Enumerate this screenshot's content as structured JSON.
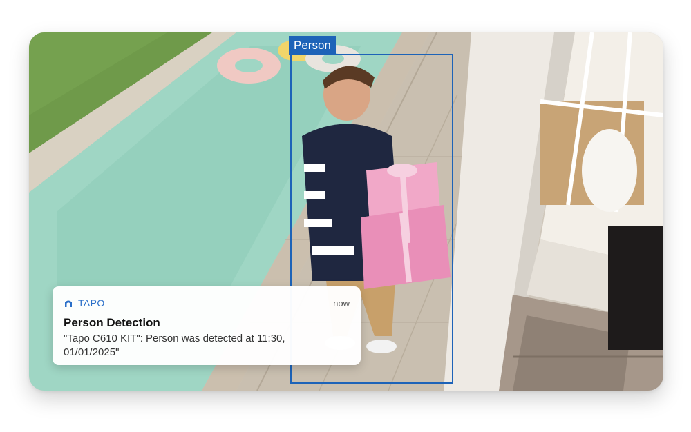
{
  "detection": {
    "label": "Person"
  },
  "notification": {
    "app_name": "TAPO",
    "time": "now",
    "title": "Person Detection",
    "body": "\"Tapo C610 KIT\": Person was detected at 11:30, 01/01/2025\""
  },
  "colors": {
    "detection_blue": "#1d63b8",
    "app_blue": "#2a6fc9"
  },
  "icons": {
    "app": "tapo-home-icon"
  }
}
